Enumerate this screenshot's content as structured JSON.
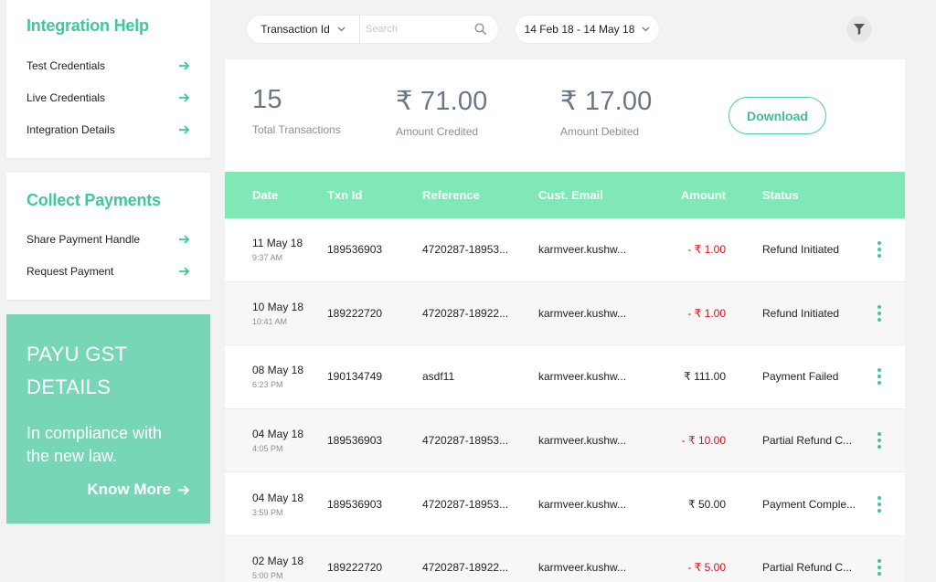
{
  "sidebar": {
    "integration": {
      "title": "Integration Help",
      "items": [
        {
          "label": "Test Credentials"
        },
        {
          "label": "Live Credentials"
        },
        {
          "label": "Integration Details"
        }
      ]
    },
    "collect": {
      "title": "Collect Payments",
      "items": [
        {
          "label": "Share Payment Handle"
        },
        {
          "label": "Request Payment"
        }
      ]
    },
    "promo": {
      "title_line1": "PAYU GST",
      "title_line2": "DETAILS",
      "subtitle_line1": "In compliance with",
      "subtitle_line2": "the new law.",
      "cta": "Know More"
    }
  },
  "toolbar": {
    "search_field": "Transaction Id",
    "search_placeholder": "Search",
    "date_range": "14 Feb 18 - 14 May 18"
  },
  "stats": {
    "total": {
      "value": "15",
      "label": "Total Transactions"
    },
    "credited": {
      "value": "₹ 71.00",
      "label": "Amount Credited"
    },
    "debited": {
      "value": "₹ 17.00",
      "label": "Amount Debited"
    },
    "download_label": "Download"
  },
  "table": {
    "headers": {
      "date": "Date",
      "txn": "Txn Id",
      "ref": "Reference",
      "email": "Cust. Email",
      "amount": "Amount",
      "status": "Status"
    },
    "rows": [
      {
        "date": "11 May 18",
        "time": "9:37 AM",
        "txn": "189536903",
        "ref": "4720287-18953...",
        "email": "karmveer.kushw...",
        "amount": "- ₹ 1.00",
        "negative": true,
        "status": "Refund Initiated"
      },
      {
        "date": "10 May 18",
        "time": "10:41 AM",
        "txn": "189222720",
        "ref": "4720287-18922...",
        "email": "karmveer.kushw...",
        "amount": "- ₹ 1.00",
        "negative": true,
        "status": "Refund Initiated"
      },
      {
        "date": "08 May 18",
        "time": "6:23 PM",
        "txn": "190134749",
        "ref": "asdf11",
        "email": "karmveer.kushw...",
        "amount": "₹ 111.00",
        "negative": false,
        "status": "Payment Failed"
      },
      {
        "date": "04 May 18",
        "time": "4:05 PM",
        "txn": "189536903",
        "ref": "4720287-18953...",
        "email": "karmveer.kushw...",
        "amount": "- ₹ 10.00",
        "negative": true,
        "status": "Partial Refund C..."
      },
      {
        "date": "04 May 18",
        "time": "3:59 PM",
        "txn": "189536903",
        "ref": "4720287-18953...",
        "email": "karmveer.kushw...",
        "amount": "₹ 50.00",
        "negative": false,
        "status": "Payment Comple..."
      },
      {
        "date": "02 May 18",
        "time": "5:00 PM",
        "txn": "189222720",
        "ref": "4720287-18922...",
        "email": "karmveer.kushw...",
        "amount": "- ₹ 5.00",
        "negative": true,
        "status": "Partial Refund C..."
      }
    ]
  },
  "colors": {
    "accent": "#3fc7a0",
    "table_header": "#80e8b7",
    "promo_bg": "#76d6b5",
    "negative": "#d0121b"
  }
}
